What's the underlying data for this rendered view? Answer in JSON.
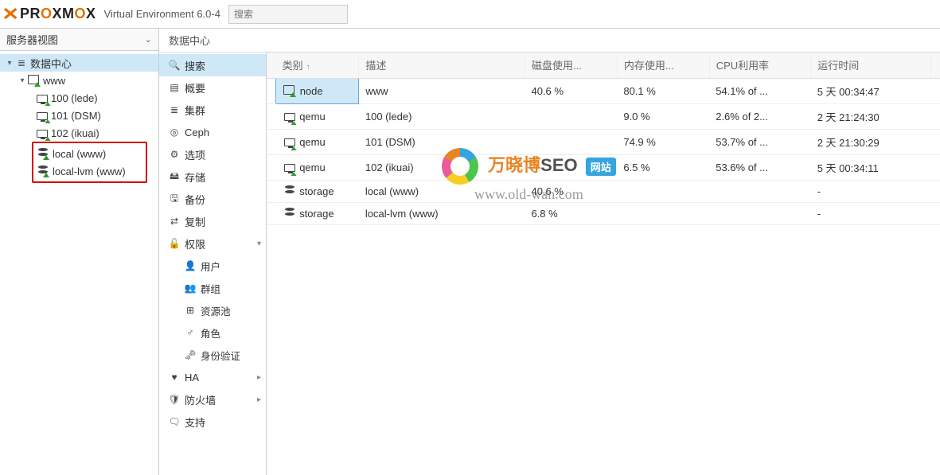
{
  "header": {
    "brand_pre": "PR",
    "brand_ox": "O",
    "brand_post": "XM",
    "brand_ox2": "O",
    "brand_x": "X",
    "ve_label": "Virtual Environment 6.0-4",
    "search_placeholder": "搜索"
  },
  "left": {
    "view_label": "服务器视图",
    "tree": {
      "root": "数据中心",
      "node": "www",
      "vms": [
        {
          "label": "100 (lede)"
        },
        {
          "label": "101 (DSM)"
        },
        {
          "label": "102 (ikuai)"
        }
      ],
      "storages": [
        {
          "label": "local (www)"
        },
        {
          "label": "local-lvm (www)"
        }
      ]
    }
  },
  "crumb": "数据中心",
  "subnav": {
    "items": [
      {
        "icon": "🔍",
        "label": "搜索",
        "selected": true
      },
      {
        "icon": "▤",
        "label": "概要"
      },
      {
        "icon": "≣",
        "label": "集群"
      },
      {
        "icon": "◎",
        "label": "Ceph"
      },
      {
        "icon": "⚙",
        "label": "选项"
      },
      {
        "icon": "🖴",
        "label": "存储"
      },
      {
        "icon": "🖫",
        "label": "备份"
      },
      {
        "icon": "⇄",
        "label": "复制"
      },
      {
        "icon": "🔓",
        "label": "权限",
        "expand": "▾"
      },
      {
        "icon": "👤",
        "label": "用户",
        "sub": true
      },
      {
        "icon": "👥",
        "label": "群组",
        "sub": true
      },
      {
        "icon": "⊞",
        "label": "资源池",
        "sub": true
      },
      {
        "icon": "♂",
        "label": "角色",
        "sub": true
      },
      {
        "icon": "🗝",
        "label": "身份验证",
        "sub": true
      },
      {
        "icon": "♥",
        "label": "HA",
        "expand": "▸"
      },
      {
        "icon": "🛡",
        "label": "防火墙",
        "expand": "▸"
      },
      {
        "icon": "🗨",
        "label": "支持"
      }
    ]
  },
  "grid": {
    "columns": [
      "类别",
      "描述",
      "磁盘使用...",
      "内存使用...",
      "CPU利用率",
      "运行时间"
    ],
    "sort_col": 0,
    "rows": [
      {
        "type": "node",
        "icon": "srv",
        "selected": true,
        "desc": "www",
        "disk": "40.6 %",
        "mem": "80.1 %",
        "cpu": "54.1% of ...",
        "uptime": "5 天 00:34:47"
      },
      {
        "type": "qemu",
        "icon": "mon",
        "desc": "100 (lede)",
        "disk": "",
        "mem": "9.0 %",
        "cpu": "2.6% of 2...",
        "uptime": "2 天 21:24:30"
      },
      {
        "type": "qemu",
        "icon": "mon",
        "desc": "101 (DSM)",
        "disk": "",
        "mem": "74.9 %",
        "cpu": "53.7% of ...",
        "uptime": "2 天 21:30:29"
      },
      {
        "type": "qemu",
        "icon": "mon",
        "desc": "102 (ikuai)",
        "disk": "",
        "mem": "6.5 %",
        "cpu": "53.6% of ...",
        "uptime": "5 天 00:34:11"
      },
      {
        "type": "storage",
        "icon": "db",
        "desc": "local (www)",
        "disk": "40.6 %",
        "mem": "",
        "cpu": "",
        "uptime": "-"
      },
      {
        "type": "storage",
        "icon": "db",
        "desc": "local-lvm (www)",
        "disk": "6.8 %",
        "mem": "",
        "cpu": "",
        "uptime": "-"
      }
    ]
  },
  "watermark": {
    "line1a": "万晓博",
    "line1b": "SEO",
    "badge": "网站",
    "line2": "www.old-wan.com"
  }
}
